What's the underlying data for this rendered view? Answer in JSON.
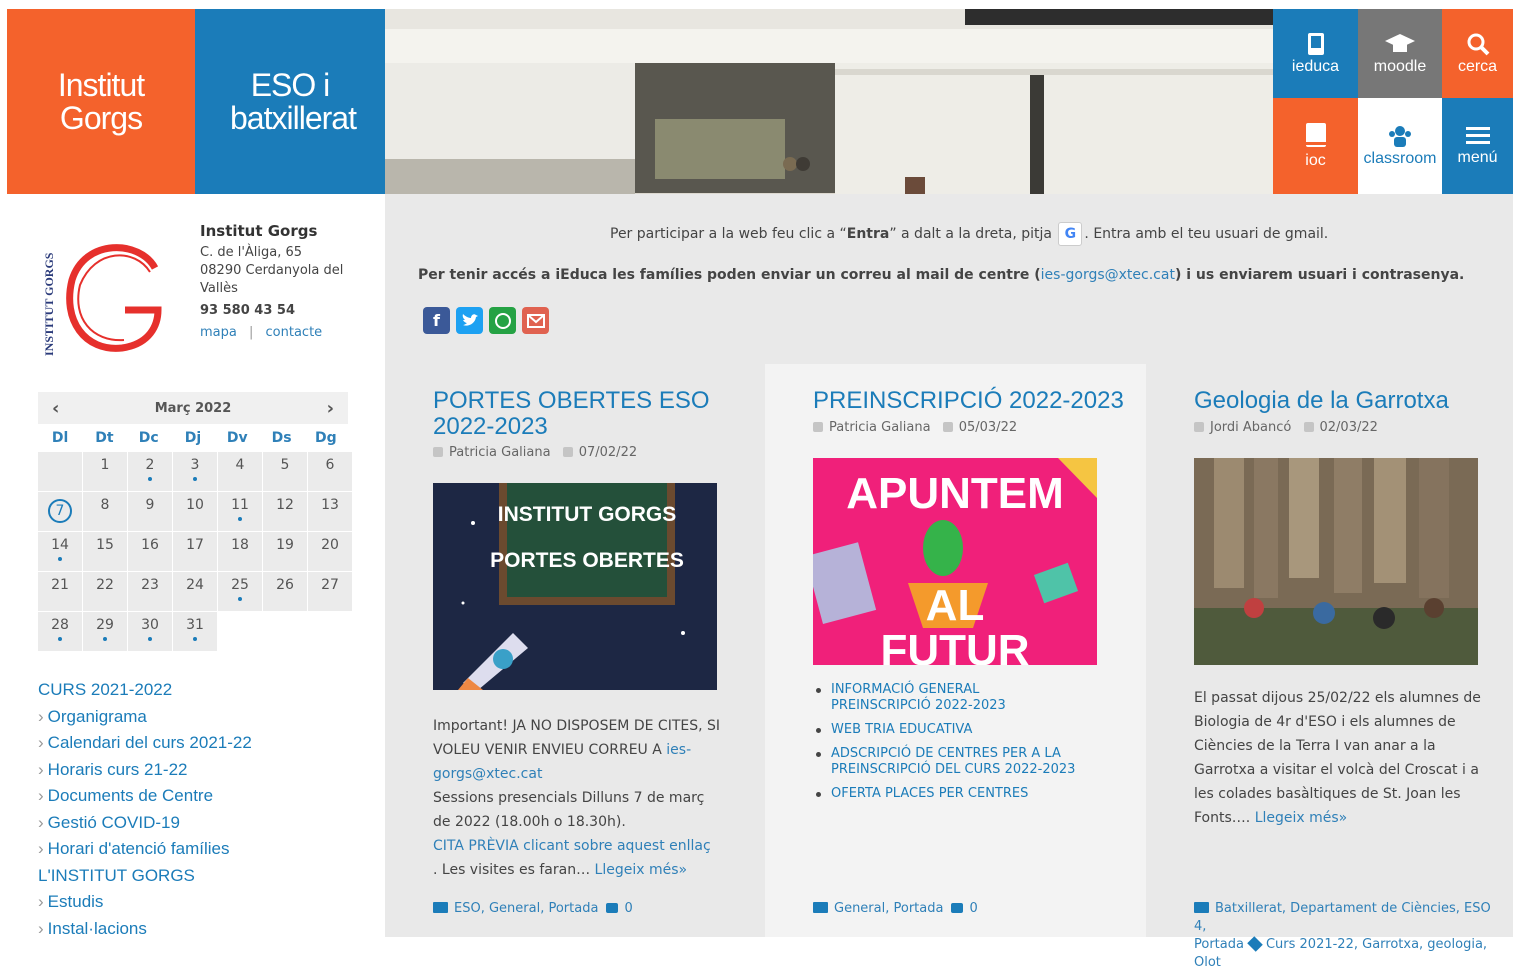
{
  "header": {
    "brand1": "Institut Gorgs",
    "brand2": "ESO i batxillerat",
    "quick": [
      {
        "label": "ieduca",
        "color": "#1b7cb9",
        "icon": "phone-icon"
      },
      {
        "label": "moodle",
        "color": "#777777",
        "icon": "graduation-cap-icon"
      },
      {
        "label": "cerca",
        "color": "#f4622c",
        "icon": "search-icon"
      },
      {
        "label": "ioc",
        "color": "#f4622c",
        "icon": "book-icon"
      },
      {
        "label": "classroom",
        "color": "#ffffff",
        "icon": "people-icon"
      },
      {
        "label": "menú",
        "color": "#1b7cb9",
        "icon": "hamburger-icon"
      }
    ]
  },
  "sidebar": {
    "name": "Institut Gorgs",
    "addr1": "C. de l'Àliga, 65",
    "addr2": "08290 Cerdanyola del",
    "addr3": "Vallès",
    "phone": "93 580 43 54",
    "map": "mapa",
    "sep": "|",
    "contact": "contacte",
    "logo_text": "INSTITUT GORGS",
    "calendar": {
      "month": "Març 2022",
      "prev": "‹",
      "next": "›",
      "daynames": [
        "Dl",
        "Dt",
        "Dc",
        "Dj",
        "Dv",
        "Ds",
        "Dg"
      ]
    },
    "menu": {
      "h1": "CURS 2021-2022",
      "i1": "Organigrama",
      "i2": "Calendari del curs 2021-22",
      "i3": "Horaris curs 21-22",
      "i4": "Documents de Centre",
      "i5": "Gestió COVID-19",
      "i6": "Horari d'atenció famílies",
      "h2": "L'INSTITUT GORGS",
      "i7": "Estudis",
      "i8": "Instal·lacions"
    }
  },
  "notice": {
    "l1a": "Per participar a la web feu clic a “",
    "l1b": "Entra",
    "l1c": "” a dalt a la dreta, pitja",
    "l1d": ". Entra amb el teu usuari de gmail.",
    "g": "G",
    "l2a": "Per tenir accés a iEduca les famílies poden enviar un correu al mail de centre (",
    "l2b": "ies-gorgs@xtec.cat",
    "l2c": ") i us enviarem usuari i contrasenya."
  },
  "posts": [
    {
      "title1": "PORTES OBERTES ESO",
      "title2": "2022-2023",
      "author": "Patricia Galiana",
      "date": "07/02/22",
      "img1": "INSTITUT GORGS",
      "img2": "PORTES OBERTES",
      "e1": "Important! JA NO DISPOSEM DE CITES, SI",
      "e2a": "VOLEU VENIR ENVIEU CORREU A ",
      "e2b": "ies-",
      "e3": "gorgs@xtec.cat",
      "e4": "Sessions presencials Dilluns 7 de març",
      "e5": "de 2022 (18.00h o 18.30h).",
      "e6": "CITA PRÈVIA clicant sobre aquest enllaç",
      "e7a": ". Les visites es faran… ",
      "e7b": "Llegeix més»",
      "cat1": "ESO",
      "cat2": "General",
      "cat3": "Portada",
      "comments": "0"
    },
    {
      "title1": "PREINSCRIPCIÓ 2022-2023",
      "author": "Patricia Galiana",
      "date": "05/03/22",
      "img1": "APUNTEM",
      "img2": "AL",
      "img3": "FUTUR",
      "l1a": "INFORMACIÓ GENERAL",
      "l1b": "PREINSCRIPCIÓ 2022-2023",
      "l2": "WEB TRIA EDUCATIVA",
      "l3a": "ADSCRIPCIÓ DE CENTRES PER A LA",
      "l3b": "PREINSCRIPCIÓ DEL CURS 2022-2023",
      "l4": "OFERTA PLACES PER CENTRES",
      "cat1": "General",
      "cat2": "Portada",
      "comments": "0"
    },
    {
      "title1": "Geologia de la Garrotxa",
      "author": "Jordi Abancó",
      "date": "02/03/22",
      "e1": "El passat dijous 25/02/22 els alumnes de",
      "e2": "Biologia de 4r d'ESO i els alumnes de",
      "e3": "Ciències de la Terra I van anar a la",
      "e4": "Garrotxa a visitar el volcà del Croscat i a",
      "e5": "les colades basàltiques de St. Joan les",
      "e6a": "Fonts…. ",
      "e6b": "Llegeix més»",
      "f1": "Batxillerat, Departament de Ciències, ESO 4,",
      "f2a": "Portada",
      "f2b": "Curs 2021-22, Garrotxa, geologia, Olot"
    }
  ]
}
